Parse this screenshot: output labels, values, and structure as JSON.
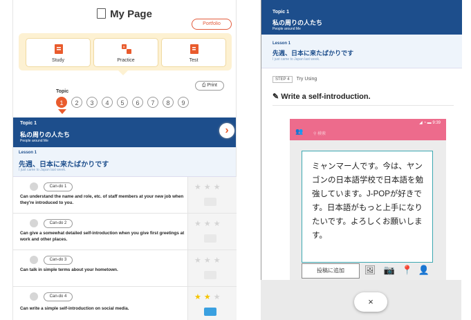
{
  "left": {
    "title": "My Page",
    "portfolio": "Portfolio",
    "cards": [
      {
        "label": "Study",
        "icon": "study-icon"
      },
      {
        "label": "Practice",
        "icon": "practice-icon"
      },
      {
        "label": "Test",
        "icon": "test-icon"
      }
    ],
    "print": "Print",
    "topic_label": "Topic",
    "topic_numbers": [
      "1",
      "2",
      "3",
      "4",
      "5",
      "6",
      "7",
      "8",
      "9"
    ],
    "topic_bar": {
      "topic": "Topic 1",
      "name": "私の周りの人たち",
      "english": "People around Me"
    },
    "lesson": {
      "num": "Lesson 1",
      "name": "先週、日本に来たばかりです",
      "english": "I just came to Japan last week."
    },
    "candos": [
      {
        "badge": "Can-do 1",
        "text": "Can understand the name and role, etc. of staff members at your new job when they're introduced to you.",
        "stars": 0
      },
      {
        "badge": "Can-do 2",
        "text": "Can give a somewhat detailed self-introduction when you give first greetings at work and other places.",
        "stars": 0
      },
      {
        "badge": "Can-do 3",
        "text": "Can talk in simple terms about your hometown.",
        "stars": 0
      },
      {
        "badge": "Can-do 4",
        "text": "Can write a simple self-introduction on social media.",
        "stars": 2
      }
    ]
  },
  "right": {
    "topic_bar": {
      "topic": "Topic 1",
      "name": "私の周りの人たち",
      "english": "People around Me"
    },
    "lesson": {
      "num": "Lesson 1",
      "name": "先週、日本に来たばかりです",
      "english": "I just came to Japan last week."
    },
    "step_badge": "STEP 4",
    "step_label": "Try Using",
    "task_title": "Write a self-introduction.",
    "phone": {
      "status": "9:39",
      "search_placeholder": "検索",
      "post_text": "ミャンマー人です。今は、ヤンゴンの日本語学校で日本語を勉強しています。J-POPが好きです。日本語がもっと上手になりたいです。よろしくお願いします。",
      "add_button": "投稿に追加"
    },
    "close": "×"
  },
  "colors": {
    "primary": "#1d4e8c",
    "accent": "#e95b2d",
    "phone_bar": "#ed6b8c",
    "cards_bg": "#fdf1d2",
    "star_on": "#f5c400"
  }
}
